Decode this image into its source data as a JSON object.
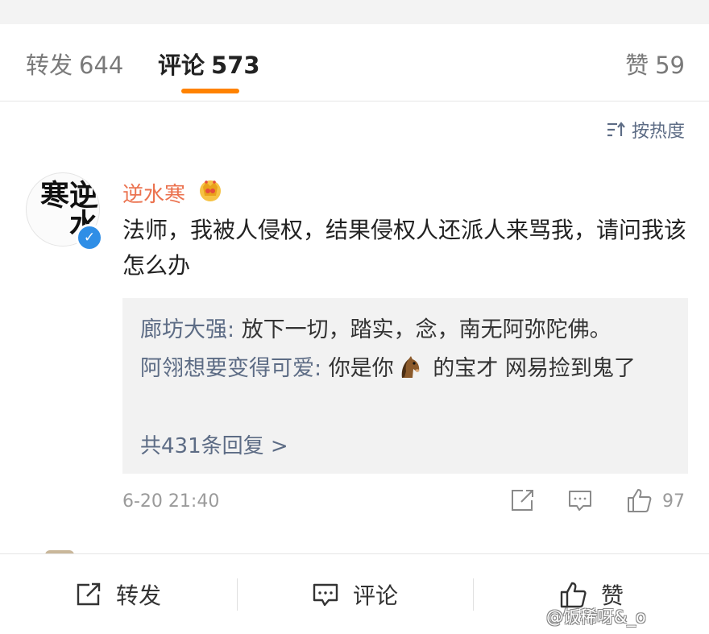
{
  "tabs": {
    "reposts": {
      "label": "转发",
      "count": "644"
    },
    "comments": {
      "label": "评论",
      "count": "573"
    },
    "likes": {
      "label": "赞",
      "count": "59"
    }
  },
  "sort": {
    "label": "按热度",
    "icon": "sort-icon"
  },
  "comment": {
    "username": "逆水寒",
    "avatar_text": "逆水寒",
    "text": "法师，我被人侵权，结果侵权人还派人来骂我，请问我该怎么办",
    "replies": [
      {
        "author": "廊坊大强",
        "separator": ": ",
        "text": "放下一切，踏实，念，南无阿弥陀佛。"
      },
      {
        "author": "阿翎想要变得可爱",
        "separator": ": ",
        "text_before": "你是你",
        "emoji": "horse-emoji",
        "text_after": " 的宝才 网易捡到鬼了"
      }
    ],
    "more_replies": "共431条回复 >",
    "timestamp": "6-20 21:40",
    "like_count": "97"
  },
  "bottom_bar": {
    "share_label": "转发",
    "comment_label": "评论",
    "like_label": "赞"
  },
  "watermark": "@饭稀呀&_o",
  "colors": {
    "accent": "#ff8200",
    "username": "#eb7350",
    "link": "#5d6c85",
    "verified": "#2f8ee6",
    "reply_bg": "#f2f2f2"
  }
}
